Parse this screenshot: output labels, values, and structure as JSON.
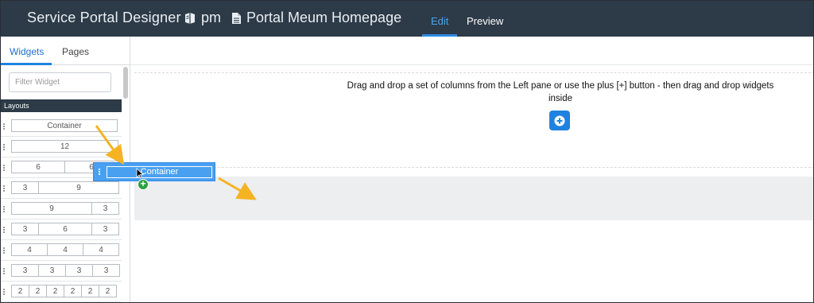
{
  "header": {
    "app_title": "Service Portal Designer",
    "portal": "pm",
    "page": "Portal Meum Homepage",
    "tabs": [
      "Edit",
      "Preview"
    ],
    "active_tab": "Edit"
  },
  "sidebar": {
    "tabs": [
      "Widgets",
      "Pages"
    ],
    "active_tab": "Widgets",
    "filter_placeholder": "Filter Widget",
    "section_title": "Layouts",
    "layouts": [
      [
        "Container"
      ],
      [
        "12"
      ],
      [
        "6",
        "6"
      ],
      [
        "3",
        "9"
      ],
      [
        "9",
        "3"
      ],
      [
        "3",
        "6",
        "3"
      ],
      [
        "4",
        "4",
        "4"
      ],
      [
        "3",
        "3",
        "3",
        "3"
      ],
      [
        "2",
        "2",
        "2",
        "2",
        "2",
        "2"
      ]
    ]
  },
  "canvas": {
    "instructions": "Drag and drop a set of columns from the Left pane or use the plus [+] button - then drag and drop widgets inside",
    "dragging_label": "Container"
  },
  "colors": {
    "header_bg": "#2d3a47",
    "accent": "#1f82e0",
    "drag_bg": "#4aa0f0",
    "arrow": "#f5b324",
    "plus_badge": "#2ea043"
  }
}
